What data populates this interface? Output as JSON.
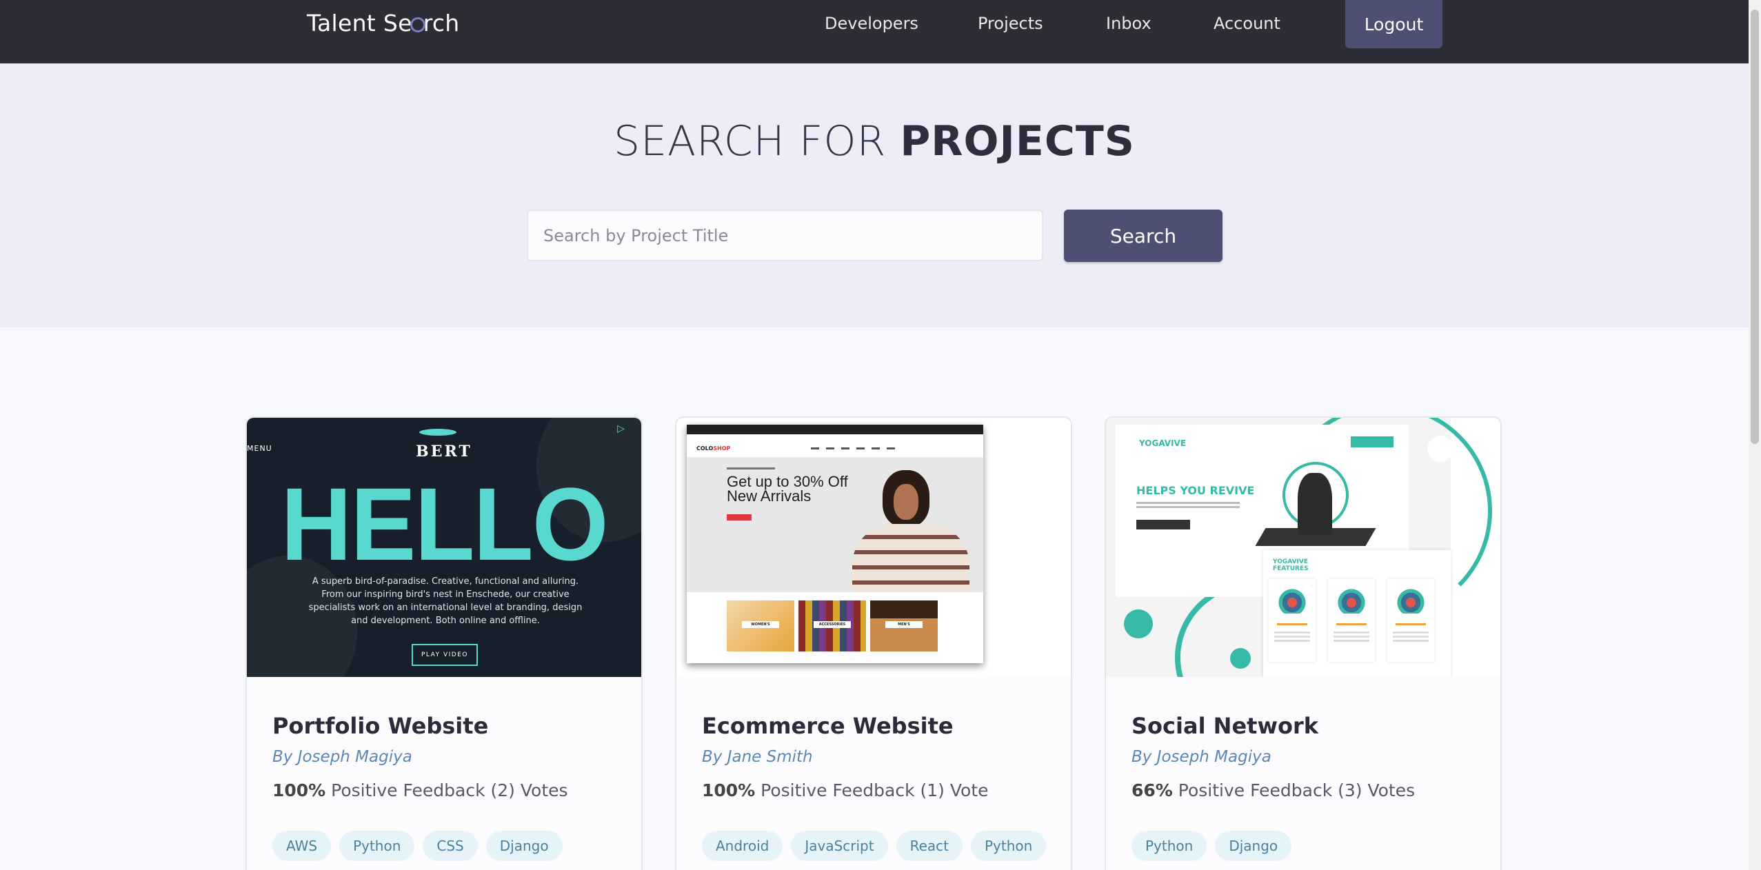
{
  "header": {
    "logo_left": "Talent Se",
    "logo_right": "rch",
    "nav": [
      "Developers",
      "Projects",
      "Inbox",
      "Account"
    ],
    "logout_label": "Logout"
  },
  "hero": {
    "title_light": "SEARCH FOR ",
    "title_bold": "PROJECTS",
    "search_placeholder": "Search by Project Title",
    "search_button": "Search"
  },
  "projects": [
    {
      "title": "Portfolio Website",
      "author": "By Joseph Magiya",
      "feedback_pct": "100%",
      "feedback_text": " Positive Feedback (2) Votes",
      "tags": [
        "AWS",
        "Python",
        "CSS",
        "Django"
      ],
      "thumb": {
        "menu": "MENU",
        "brand": "BERT",
        "headline": "HELLO",
        "blurb": "A superb bird-of-paradise. Creative, functional and alluring. From our inspiring bird's nest in Enschede, our creative specialists work on an international level at branding, design and development. Both online and offline.",
        "button": "PLAY VIDEO"
      }
    },
    {
      "title": "Ecommerce Website",
      "author": "By Jane Smith",
      "feedback_pct": "100%",
      "feedback_text": " Positive Feedback (1) Vote",
      "tags": [
        "Android",
        "JavaScript",
        "React",
        "Python"
      ],
      "thumb": {
        "logo_a": "COLO",
        "logo_b": "SHOP",
        "headline_1": "Get up to 30% Off",
        "headline_2": "New Arrivals",
        "categories": [
          "WOMEN'S",
          "ACCESSORIES",
          "MEN'S"
        ]
      }
    },
    {
      "title": "Social Network",
      "author": "By Joseph Magiya",
      "feedback_pct": "66%",
      "feedback_text": " Positive Feedback (3) Votes",
      "tags": [
        "Python",
        "Django"
      ],
      "thumb": {
        "logo": "YOGAVIVE",
        "headline": "HELPS YOU REVIVE",
        "features_title_1": "YOGAVIVE",
        "features_title_2": "FEATURES"
      }
    }
  ],
  "colors": {
    "navbar_bg": "#2c2d35",
    "hero_bg": "#ededf8",
    "primary_button": "#4d5072",
    "author_color": "#5a87b3",
    "tag_bg": "#e6f4fa",
    "teal_accent": "#58d8ce"
  }
}
